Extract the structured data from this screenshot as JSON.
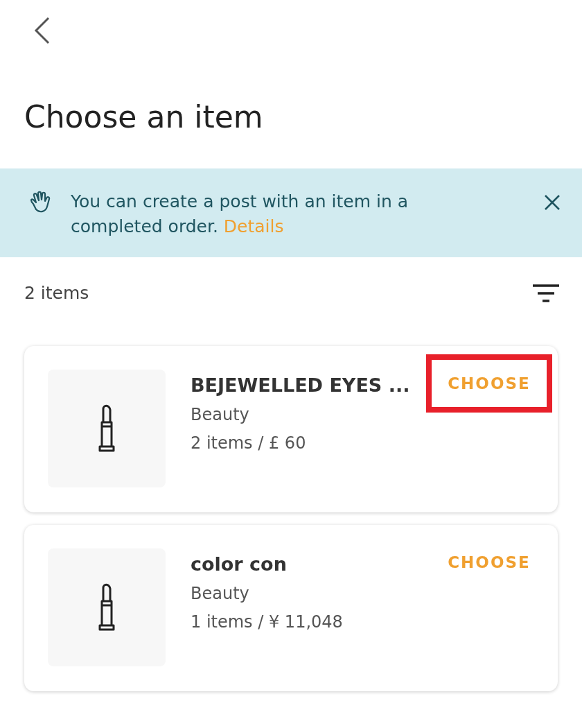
{
  "title": "Choose an item",
  "banner": {
    "text": "You can create a post with an item in a completed order.",
    "link": "Details"
  },
  "count": "2 items",
  "items": [
    {
      "name": "BEJEWELLED EYES ...",
      "category": "Beauty",
      "summary": "2 items / £ 60",
      "action": "CHOOSE",
      "highlighted": true
    },
    {
      "name": "color con",
      "category": "Beauty",
      "summary": "1 items / ¥ 11,048",
      "action": "CHOOSE",
      "highlighted": false
    }
  ]
}
